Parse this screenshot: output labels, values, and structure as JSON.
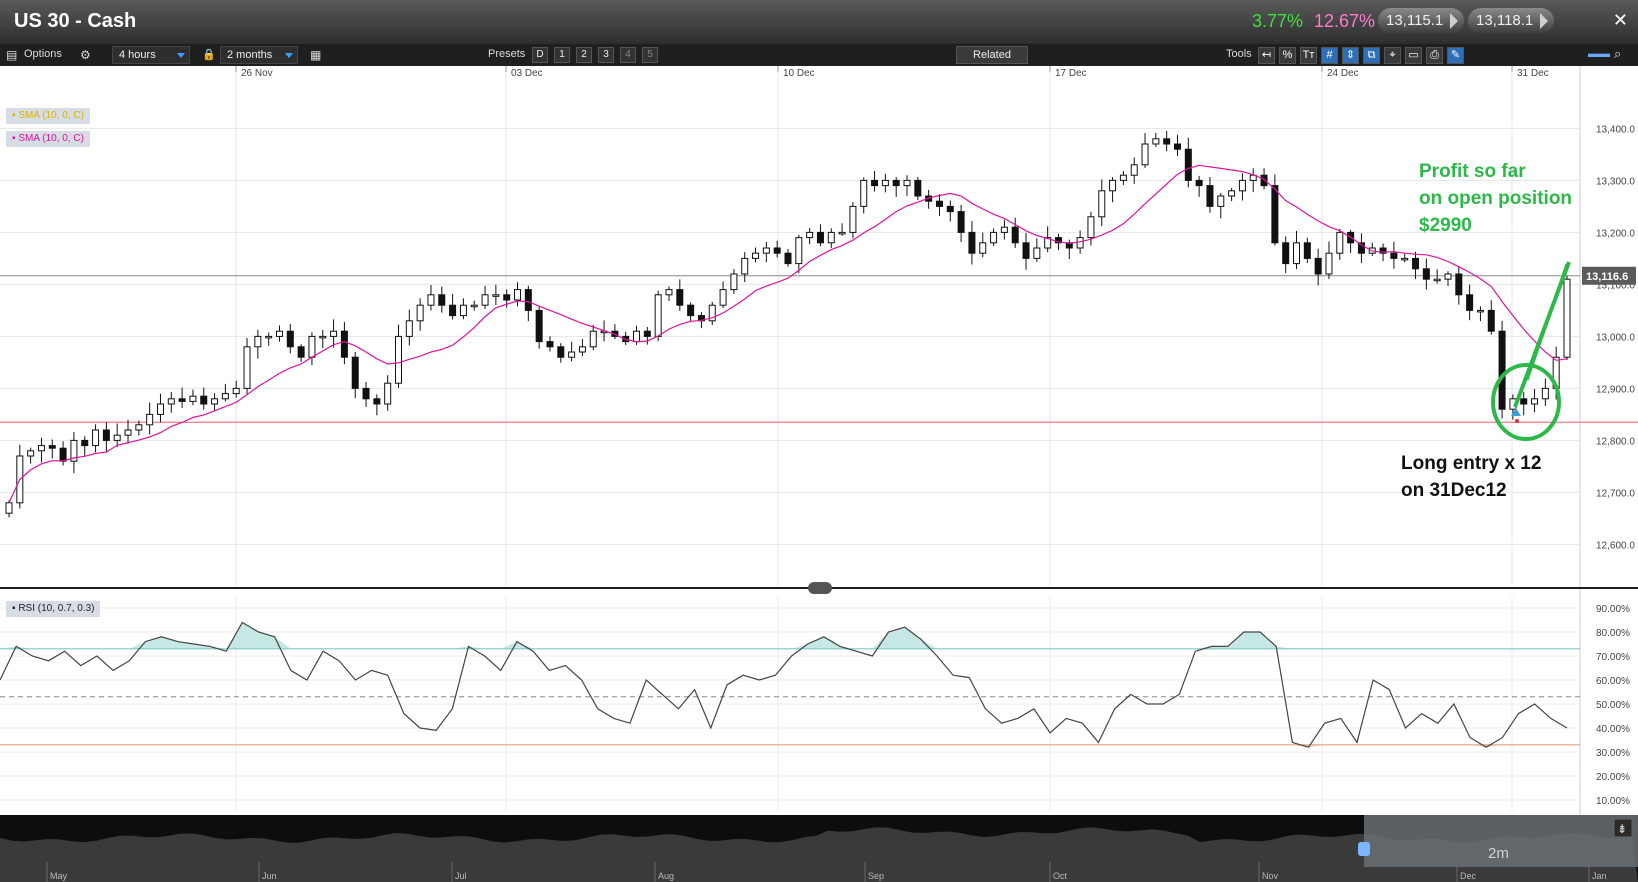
{
  "window": {
    "title": "US 30 - Cash",
    "change_pct": "3.77%",
    "change_pct2": "12.67%",
    "bid": "13,115.1",
    "ask": "13,118.1",
    "close_glyph": "✕"
  },
  "toolbar": {
    "options_label": "Options",
    "interval": "4 hours",
    "range": "2 months",
    "presets_label": "Presets",
    "presets": [
      "D",
      "1",
      "2",
      "3",
      "4",
      "5"
    ],
    "related_label": "Related",
    "tools_label": "Tools",
    "tool_glyphs": [
      "↤",
      "%",
      "Tт",
      "#",
      "⇕",
      "⧉",
      "⌖",
      "▭",
      "⎙",
      "✎"
    ]
  },
  "colors": {
    "sma": "#e0149a",
    "sma_legend1": "#d8b400",
    "overbought": "#7fc9c2",
    "oversold": "#e4a27a",
    "annotation": "#2db84a",
    "price_line": "#888888",
    "entry_line": "#e8606a"
  },
  "chart_data": [
    {
      "type": "candlestick",
      "x_ticks": [
        "26 Nov",
        "03 Dec",
        "10 Dec",
        "17 Dec",
        "24 Dec",
        "31 Dec"
      ],
      "y_ticks": [
        "13,400.0",
        "13,300.0",
        "13,200.0",
        "13,100.0",
        "13,000.0",
        "12,900.0",
        "12,800.0",
        "12,700.0",
        "12,600.0"
      ],
      "ylim": [
        12520,
        13520
      ],
      "legend": [
        "SMA (10, 0, C)",
        "SMA (10, 0, C)"
      ],
      "last_price": 13116.6,
      "last_price_label": "13,116.6",
      "entry_level": 12835,
      "closes": [
        12680,
        12770,
        12780,
        12790,
        12785,
        12760,
        12800,
        12790,
        12820,
        12800,
        12810,
        12820,
        12830,
        12850,
        12870,
        12880,
        12875,
        12885,
        12870,
        12880,
        12890,
        12900,
        12980,
        13000,
        13000,
        13010,
        12980,
        12960,
        13000,
        13000,
        13010,
        12960,
        12900,
        12880,
        12870,
        12910,
        13000,
        13030,
        13060,
        13080,
        13060,
        13040,
        13060,
        13060,
        13080,
        13080,
        13070,
        13090,
        13050,
        12990,
        12980,
        12960,
        12970,
        12980,
        13010,
        13010,
        13000,
        12990,
        13010,
        13000,
        13080,
        13090,
        13060,
        13040,
        13030,
        13060,
        13090,
        13120,
        13150,
        13160,
        13170,
        13160,
        13140,
        13190,
        13200,
        13180,
        13200,
        13200,
        13250,
        13300,
        13290,
        13300,
        13290,
        13300,
        13270,
        13260,
        13250,
        13240,
        13200,
        13160,
        13180,
        13200,
        13210,
        13180,
        13150,
        13170,
        13190,
        13180,
        13170,
        13190,
        13230,
        13280,
        13300,
        13310,
        13330,
        13370,
        13380,
        13370,
        13360,
        13300,
        13290,
        13250,
        13270,
        13280,
        13300,
        13310,
        13290,
        13180,
        13140,
        13180,
        13150,
        13120,
        13160,
        13200,
        13180,
        13160,
        13170,
        13160,
        13150,
        13150,
        13130,
        13110,
        13110,
        13120,
        13080,
        13050,
        13050,
        13010,
        12860,
        12880,
        12870,
        12880,
        12900,
        12960,
        13110
      ]
    },
    {
      "type": "line",
      "legend": "RSI (10, 0.7, 0.3)",
      "y_ticks": [
        "90.00%",
        "80.00%",
        "70.00%",
        "60.00%",
        "50.00%",
        "40.00%",
        "30.00%",
        "20.00%",
        "10.00%"
      ],
      "ylim": [
        5,
        95
      ],
      "overbought": 73,
      "oversold": 33,
      "mid": 53,
      "values": [
        60,
        74,
        70,
        68,
        72,
        66,
        70,
        64,
        68,
        76,
        78,
        76,
        75,
        74,
        72,
        84,
        80,
        78,
        64,
        60,
        72,
        68,
        60,
        64,
        62,
        46,
        40,
        39,
        48,
        74,
        70,
        64,
        76,
        72,
        64,
        66,
        60,
        48,
        44,
        42,
        60,
        54,
        48,
        56,
        40,
        58,
        62,
        60,
        62,
        70,
        75,
        78,
        74,
        72,
        70,
        80,
        82,
        77,
        70,
        62,
        61,
        48,
        42,
        44,
        48,
        38,
        44,
        42,
        34,
        48,
        54,
        50,
        50,
        54,
        72,
        74,
        74,
        80,
        80,
        74,
        34,
        32,
        42,
        44,
        34,
        60,
        56,
        40,
        46,
        42,
        50,
        36,
        32,
        36,
        46,
        50,
        44,
        40
      ]
    },
    {
      "type": "area",
      "role": "navigator",
      "x_ticks": [
        "May",
        "Jun",
        "Jul",
        "Aug",
        "Sep",
        "Oct",
        "Nov",
        "Dec",
        "Jan"
      ],
      "window_label": "2m"
    }
  ]
}
